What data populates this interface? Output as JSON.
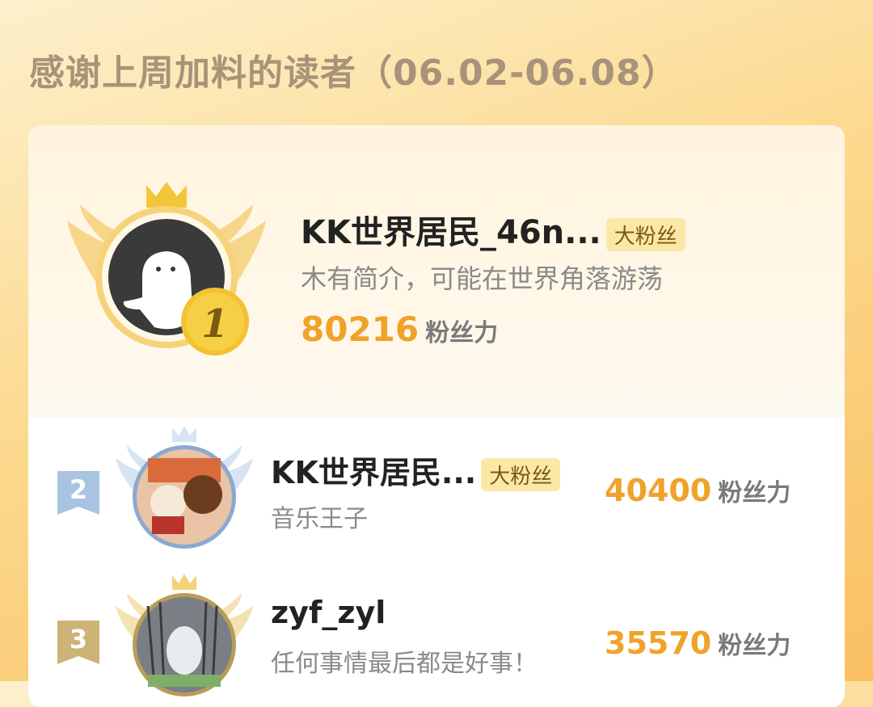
{
  "header": {
    "title": "感谢上周加料的读者（06.02-06.08）"
  },
  "leader": {
    "rank": "1",
    "name": "KK世界居民_46n...",
    "badge": "大粉丝",
    "bio": "木有简介，可能在世界角落游荡",
    "score": "80216",
    "score_unit": "粉丝力"
  },
  "rows": [
    {
      "rank": "2",
      "name": "KK世界居民...",
      "badge": "大粉丝",
      "bio": "音乐王子",
      "score": "40400",
      "score_unit": "粉丝力"
    },
    {
      "rank": "3",
      "name": "zyf_zyl",
      "badge": "",
      "bio": "任何事情最后都是好事！",
      "score": "35570",
      "score_unit": "粉丝力"
    }
  ],
  "colors": {
    "accent": "#f0a22a",
    "gold": "#f3c230",
    "silver": "#9bb8d8",
    "bronze": "#c8ab66"
  },
  "icons": {
    "crown": "crown-icon",
    "wings": "wings-icon"
  }
}
